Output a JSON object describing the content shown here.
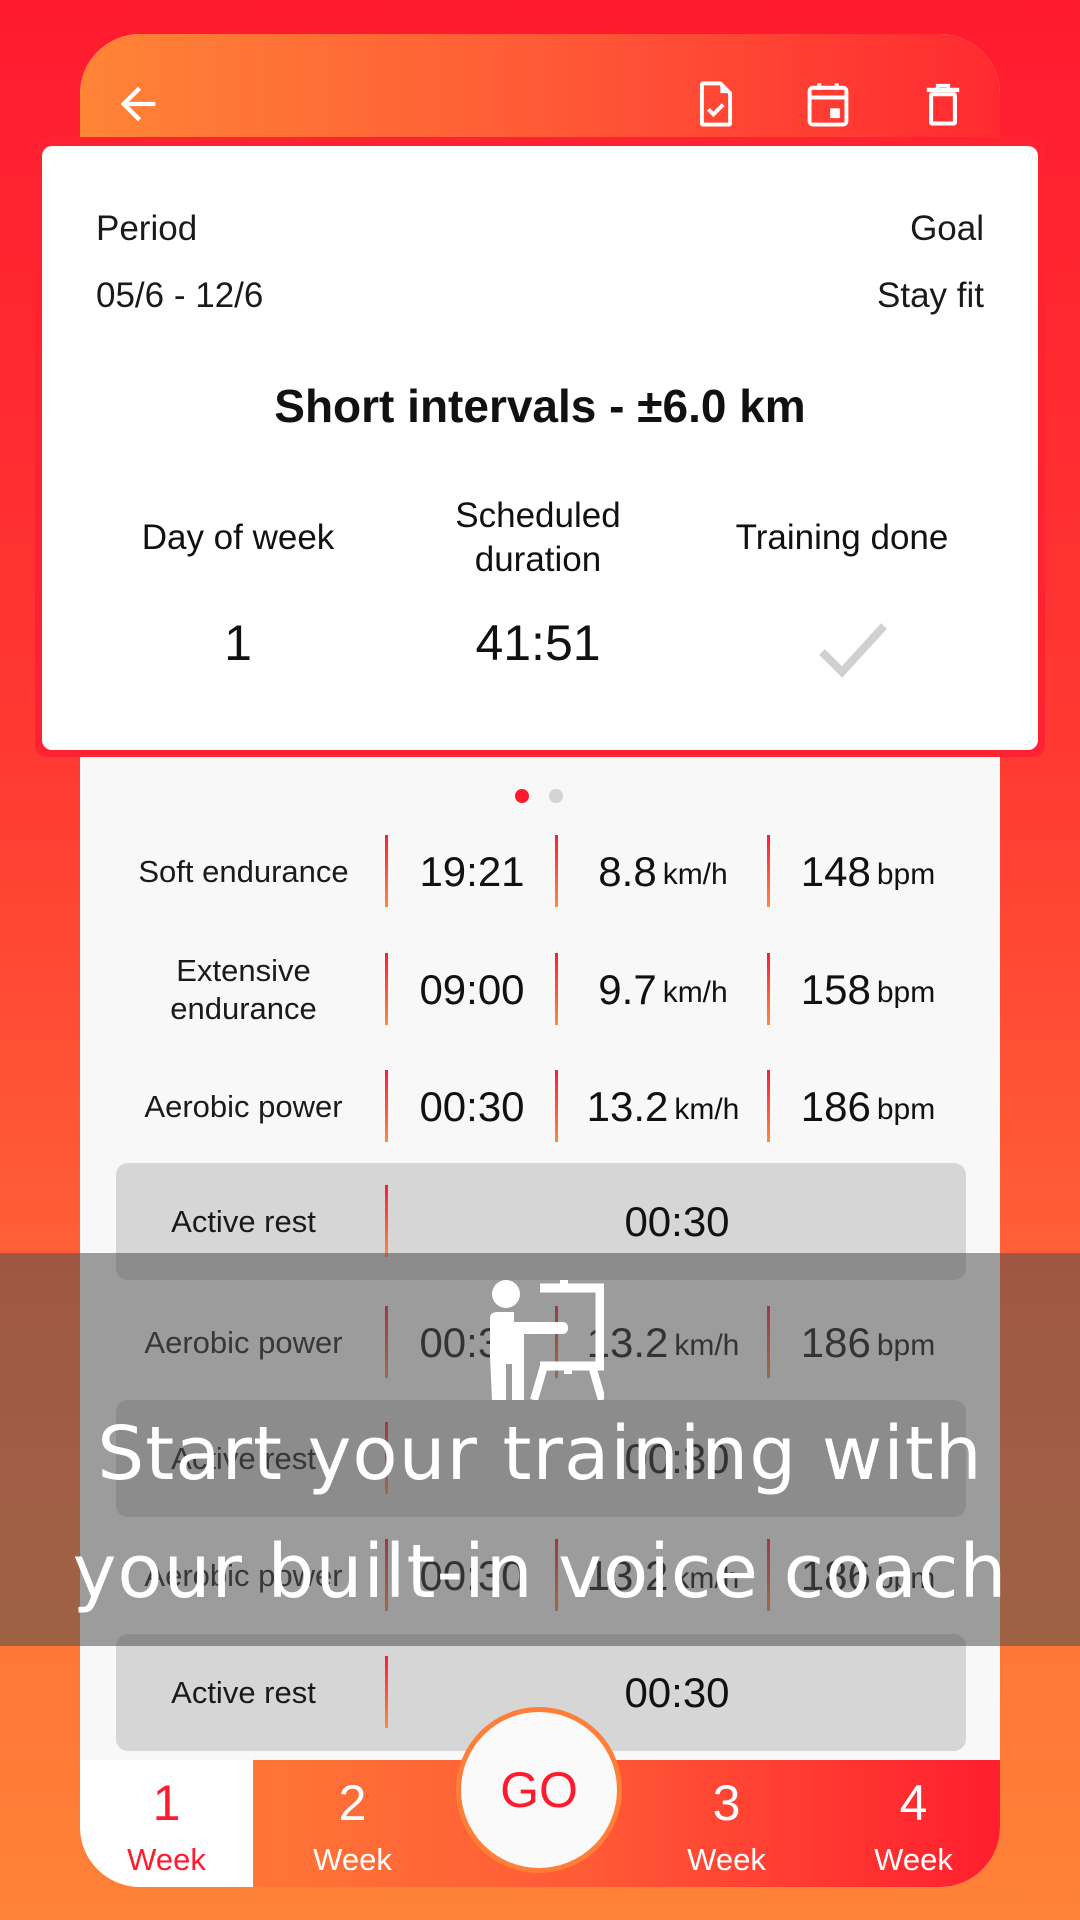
{
  "toolbar": {
    "back_icon": "arrow-left-icon",
    "actions": [
      {
        "name": "mark-done",
        "icon": "file-check-icon"
      },
      {
        "name": "schedule",
        "icon": "calendar-icon"
      },
      {
        "name": "delete",
        "icon": "trash-icon"
      }
    ]
  },
  "summary": {
    "period_label": "Period",
    "period_value": "05/6 - 12/6",
    "goal_label": "Goal",
    "goal_value": "Stay fit",
    "title": "Short intervals - ±6.0 km",
    "columns": [
      {
        "header": "Day of week",
        "value": "1"
      },
      {
        "header": "Scheduled\nduration",
        "value": "41:51"
      },
      {
        "header": "Training done",
        "value": "check-icon",
        "done": true
      }
    ],
    "pager": {
      "pages": 2,
      "current": 1
    }
  },
  "colors": {
    "accent_red": "#ff1a2e",
    "accent_orange": "#ff8236",
    "rest_row": "#d6d6d6",
    "check_gray": "#d0d0d0"
  },
  "segments": [
    {
      "name": "Soft endurance",
      "type": "work",
      "duration": "19:21",
      "speed": "8.8",
      "speed_unit": "km/h",
      "hr": "148",
      "hr_unit": "bpm"
    },
    {
      "name": "Extensive endurance",
      "type": "work",
      "duration": "09:00",
      "speed": "9.7",
      "speed_unit": "km/h",
      "hr": "158",
      "hr_unit": "bpm"
    },
    {
      "name": "Aerobic power",
      "type": "work",
      "duration": "00:30",
      "speed": "13.2",
      "speed_unit": "km/h",
      "hr": "186",
      "hr_unit": "bpm"
    },
    {
      "name": "Active rest",
      "type": "rest",
      "duration": "00:30"
    },
    {
      "name": "Aerobic power",
      "type": "work",
      "duration": "00:30",
      "speed": "13.2",
      "speed_unit": "km/h",
      "hr": "186",
      "hr_unit": "bpm"
    },
    {
      "name": "Active rest",
      "type": "rest",
      "duration": "00:30"
    },
    {
      "name": "Aerobic power",
      "type": "work",
      "duration": "00:30",
      "speed": "13.2",
      "speed_unit": "km/h",
      "hr": "186",
      "hr_unit": "bpm"
    },
    {
      "name": "Active rest",
      "type": "rest",
      "duration": "00:30"
    }
  ],
  "bottom_nav": {
    "tabs": [
      {
        "num": "1",
        "label": "Week",
        "active": true
      },
      {
        "num": "2",
        "label": "Week",
        "active": false
      },
      {
        "num": "3",
        "label": "Week",
        "active": false
      },
      {
        "num": "4",
        "label": "Week",
        "active": false
      }
    ],
    "go_label": "GO"
  },
  "promo": {
    "icon": "presentation-coach-icon",
    "line1": "Start your training with",
    "line2": "your built-in voice coach"
  }
}
